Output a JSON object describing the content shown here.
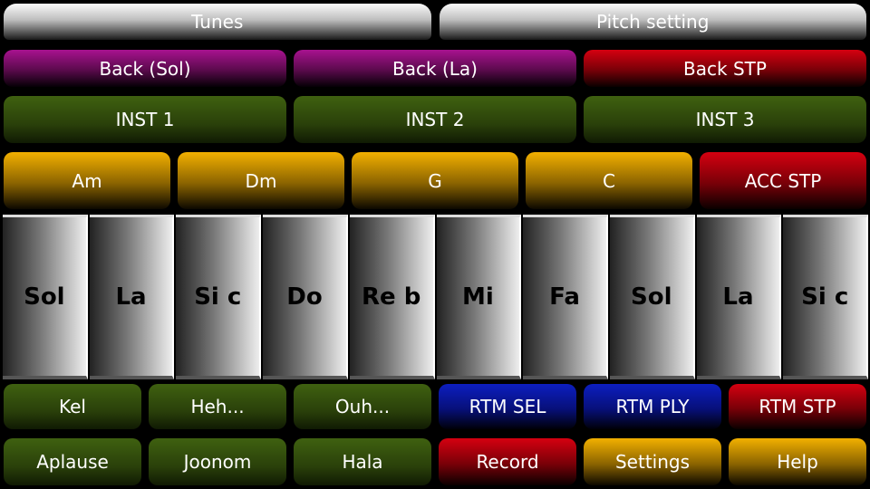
{
  "top": [
    "Tunes",
    "Pitch setting"
  ],
  "backing": [
    "Back (Sol)",
    "Back (La)",
    "Back STP"
  ],
  "instruments": [
    "INST 1",
    "INST 2",
    "INST 3"
  ],
  "chords": [
    "Am",
    "Dm",
    "G",
    "C",
    "ACC STP"
  ],
  "keys": [
    "Sol",
    "La",
    "Si c",
    "Do",
    "Re b",
    "Mi",
    "Fa",
    "Sol",
    "La",
    "Si c"
  ],
  "row5": [
    "Kel",
    "Heh...",
    "Ouh...",
    "RTM SEL",
    "RTM PLY",
    "RTM STP"
  ],
  "row6": [
    "Aplause",
    "Joonom",
    "Hala",
    "Record",
    "Settings",
    "Help"
  ],
  "colors": {
    "purple": "#a8128f",
    "green": "#3f6110",
    "orange": "#f2b000",
    "red": "#d50010",
    "blue": "#0c1ec0"
  }
}
